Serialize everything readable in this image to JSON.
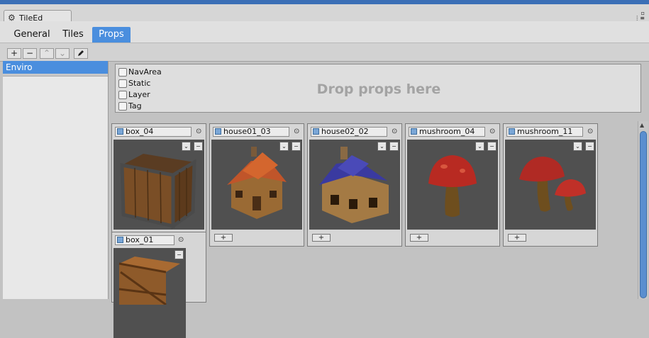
{
  "window": {
    "title": "TileEd",
    "gear_icon": "gear-icon",
    "controls": "▫\n▾≡"
  },
  "tabs": [
    {
      "label": "General",
      "active": false
    },
    {
      "label": "Tiles",
      "active": false
    },
    {
      "label": "Props",
      "active": true
    }
  ],
  "toolbar": {
    "add": "+",
    "remove": "−",
    "up": "⌃",
    "down": "⌄",
    "edit_icon": "pencil-icon"
  },
  "groups": [
    {
      "label": "Enviro",
      "selected": true
    }
  ],
  "dropzone": {
    "text": "Drop props here",
    "checkboxes": [
      {
        "label": "NavArea",
        "checked": false
      },
      {
        "label": "Static",
        "checked": false
      },
      {
        "label": "Layer",
        "checked": false
      },
      {
        "label": "Tag",
        "checked": false
      }
    ]
  },
  "props": [
    {
      "name": "box_04"
    },
    {
      "name": "house01_03"
    },
    {
      "name": "house02_02"
    },
    {
      "name": "mushroom_04"
    },
    {
      "name": "mushroom_11"
    },
    {
      "name": "box_01"
    }
  ],
  "card_controls": {
    "dropdown": "⌄",
    "remove": "−",
    "add": "+",
    "target": "⊙"
  },
  "colors": {
    "accent": "#4a8ede",
    "title_strip": "#3b6fb6",
    "thumb_bg": "#505050"
  }
}
